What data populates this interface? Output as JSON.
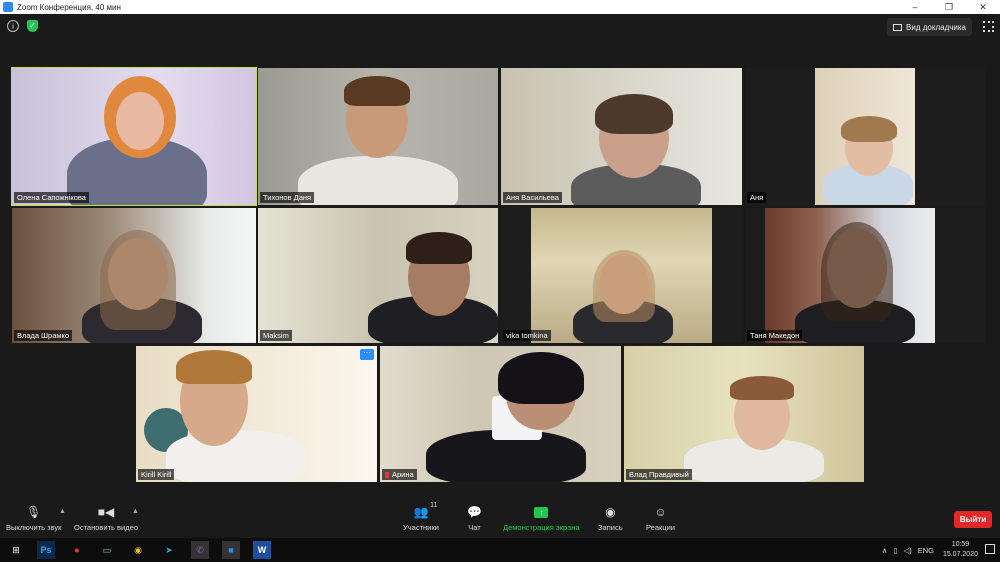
{
  "window": {
    "title": "Zoom Конференция, 40 мин",
    "controls": [
      "–",
      "❐",
      "✕"
    ]
  },
  "top_bar": {
    "speaker_view_label": "Вид докладчика"
  },
  "participants": [
    {
      "name": "Олена Сапожнікова",
      "muted": false,
      "active": true
    },
    {
      "name": "Тихонов Даня",
      "muted": false
    },
    {
      "name": "Аня Васильева",
      "muted": false
    },
    {
      "name": "Аня",
      "muted": false
    },
    {
      "name": "Влада Шрамко",
      "muted": false
    },
    {
      "name": "Maksim",
      "muted": false
    },
    {
      "name": "vika tomkina",
      "muted": false
    },
    {
      "name": "Таня Македон",
      "muted": false
    },
    {
      "name": "Kirill Kirill",
      "muted": false
    },
    {
      "name": "Арина",
      "muted": true
    },
    {
      "name": "Влад Правдивый",
      "muted": false
    }
  ],
  "more_button_label": "···",
  "toolbar": {
    "mute_label": "Выключить звук",
    "video_label": "Остановить видео",
    "participants_label": "Участники",
    "participants_count": "11",
    "chat_label": "Чат",
    "share_label": "Демонстрация экрана",
    "record_label": "Запись",
    "reactions_label": "Реакции",
    "leave_label": "Выйти"
  },
  "taskbar": {
    "lang": "ENG",
    "time": "10:59",
    "date": "15.07.2020",
    "apps": [
      "windows-start",
      "photoshop",
      "recorder",
      "file-explorer",
      "chrome",
      "telegram",
      "viber",
      "zoom",
      "word"
    ]
  }
}
